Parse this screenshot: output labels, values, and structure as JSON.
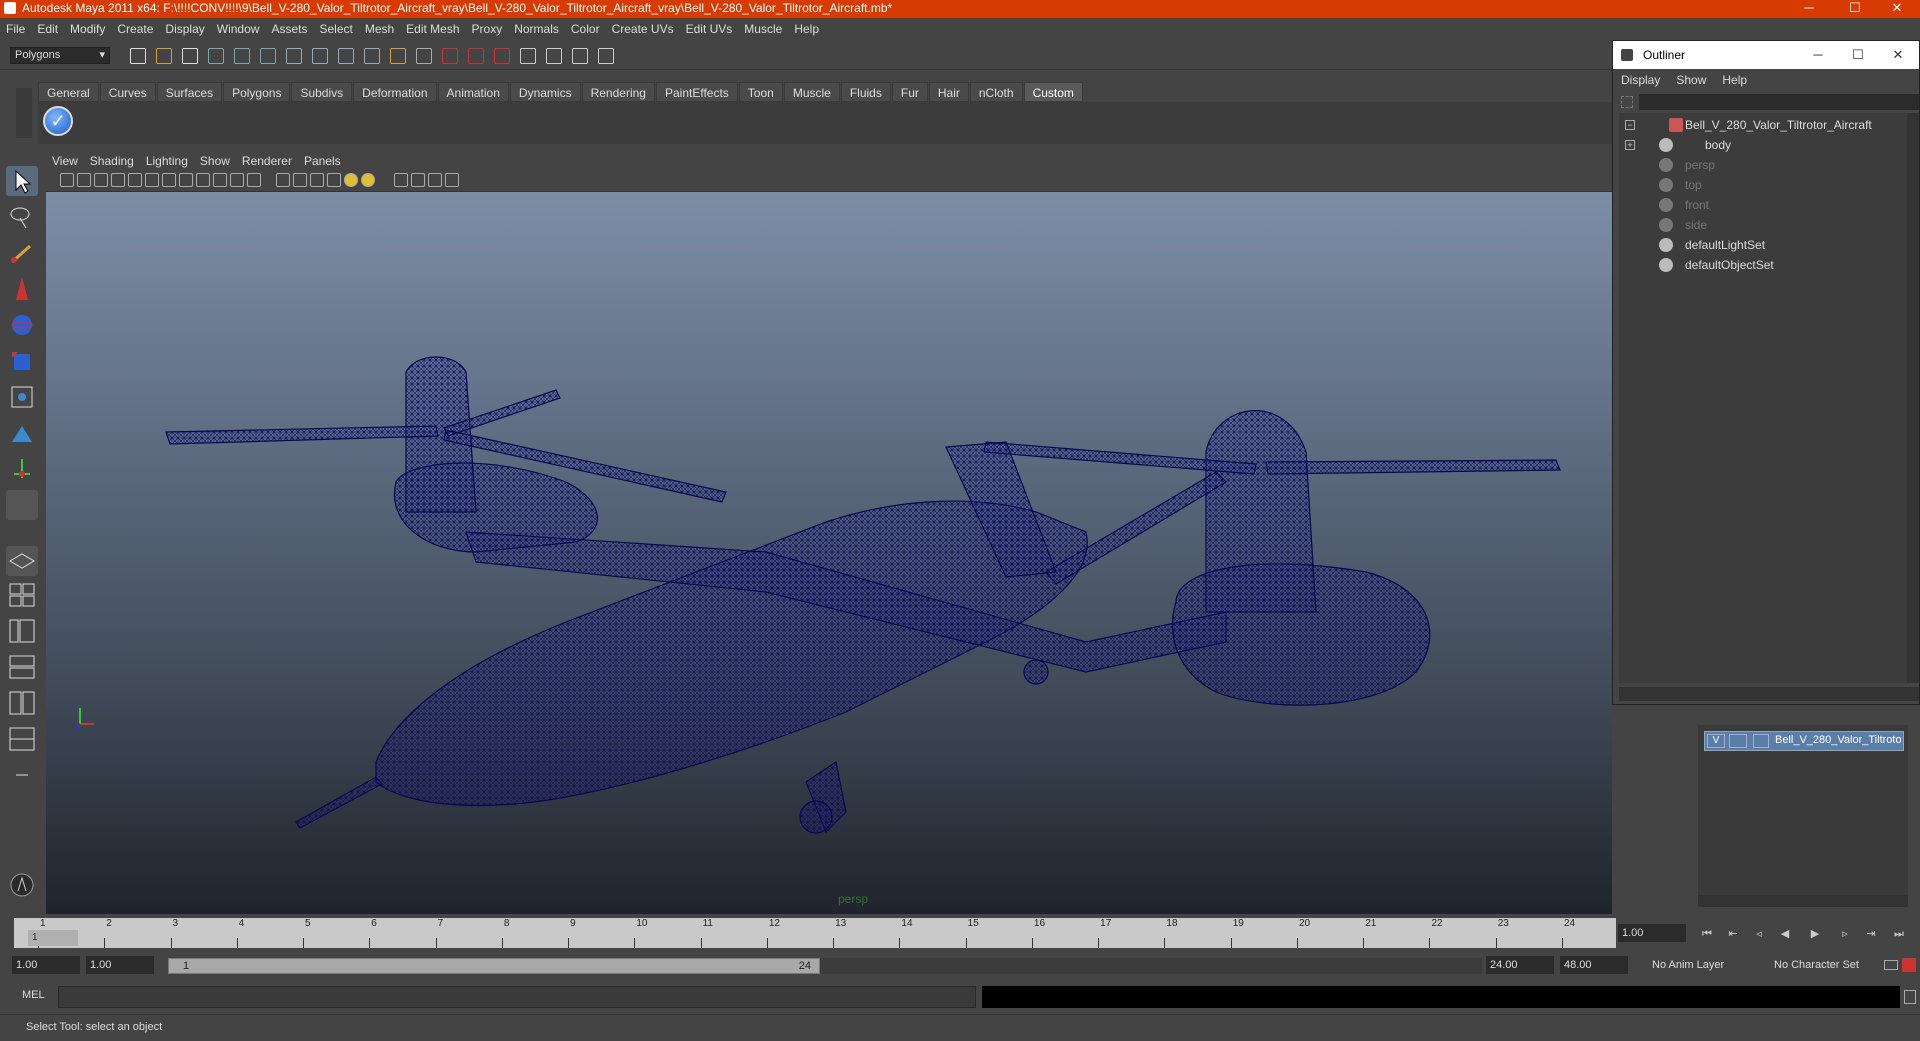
{
  "window": {
    "title": "Autodesk Maya 2011 x64: F:\\!!!!CONV!!!!\\9\\Bell_V-280_Valor_Tiltrotor_Aircraft_vray\\Bell_V-280_Valor_Tiltrotor_Aircraft_vray\\Bell_V-280_Valor_Tiltrotor_Aircraft.mb*",
    "title_bar_color": "#d83b01",
    "minimize": "─",
    "maximize": "☐",
    "close": "✕"
  },
  "menubar": [
    "File",
    "Edit",
    "Modify",
    "Create",
    "Display",
    "Window",
    "Assets",
    "Select",
    "Mesh",
    "Edit Mesh",
    "Proxy",
    "Normals",
    "Color",
    "Create UVs",
    "Edit UVs",
    "Muscle",
    "Help"
  ],
  "statusline": {
    "mode": "Polygons"
  },
  "shelf": {
    "tabs": [
      "General",
      "Curves",
      "Surfaces",
      "Polygons",
      "Subdivs",
      "Deformation",
      "Animation",
      "Dynamics",
      "Rendering",
      "PaintEffects",
      "Toon",
      "Muscle",
      "Fluids",
      "Fur",
      "Hair",
      "nCloth",
      "Custom"
    ],
    "active_tab": "Custom"
  },
  "panel": {
    "menus": [
      "View",
      "Shading",
      "Lighting",
      "Show",
      "Renderer",
      "Panels"
    ],
    "camera": "persp"
  },
  "outliner": {
    "title": "Outliner",
    "menus": [
      "Display",
      "Show",
      "Help"
    ],
    "items": [
      {
        "label": "Bell_V_280_Valor_Tiltrotor_Aircraft",
        "dim": false
      },
      {
        "label": "body",
        "dim": false
      },
      {
        "label": "persp",
        "dim": true
      },
      {
        "label": "top",
        "dim": true
      },
      {
        "label": "front",
        "dim": true
      },
      {
        "label": "side",
        "dim": true
      },
      {
        "label": "defaultLightSet",
        "dim": false
      },
      {
        "label": "defaultObjectSet",
        "dim": false
      }
    ]
  },
  "layers": {
    "visible_flag": "V",
    "name": "Bell_V_280_Valor_Tiltroto"
  },
  "timeline": {
    "ticks": [
      "1",
      "2",
      "3",
      "4",
      "5",
      "6",
      "7",
      "8",
      "9",
      "10",
      "11",
      "12",
      "13",
      "14",
      "15",
      "16",
      "17",
      "18",
      "19",
      "20",
      "21",
      "22",
      "23",
      "24"
    ],
    "current_marker": "1",
    "current_frame": "1.00"
  },
  "range": {
    "start": "1.00",
    "inner_start": "1.00",
    "handle_start": "1",
    "handle_end": "24",
    "inner_end": "24.00",
    "end": "48.00",
    "anim_layer": "No Anim Layer",
    "character_set": "No Character Set"
  },
  "command": {
    "label": "MEL"
  },
  "help": "Select Tool: select an object",
  "wire_color": "#0a0a6a"
}
